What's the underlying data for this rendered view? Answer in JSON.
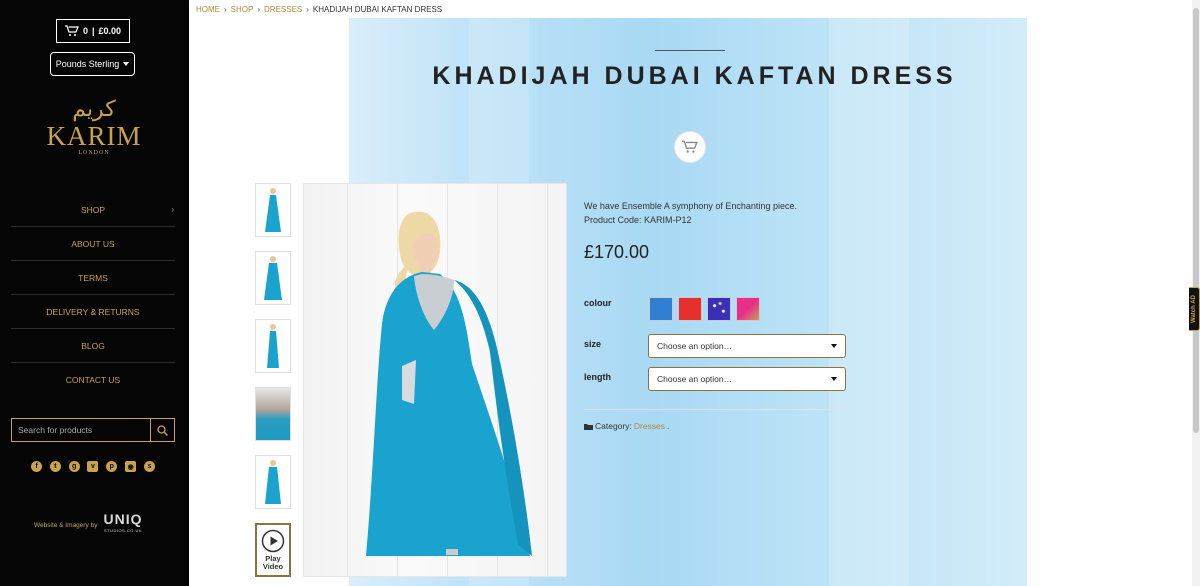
{
  "header": {
    "cart_count": "0",
    "cart_total": "£0.00",
    "currency": "Pounds Sterling"
  },
  "logo": {
    "arabic": "كريم",
    "name": "KARIM",
    "sub": "LONDON"
  },
  "nav": {
    "items": [
      {
        "label": "SHOP"
      },
      {
        "label": "ABOUT US"
      },
      {
        "label": "TERMS"
      },
      {
        "label": "DELIVERY & RETURNS"
      },
      {
        "label": "BLOG"
      },
      {
        "label": "CONTACT US"
      }
    ]
  },
  "search": {
    "placeholder": "Search for products"
  },
  "social_icons": [
    "facebook-icon",
    "twitter-icon",
    "google-plus-icon",
    "vimeo-icon",
    "pinterest-icon",
    "instagram-icon",
    "skype-icon"
  ],
  "credit": {
    "text": "Website & Imagery by",
    "brand": "UNIQ",
    "brand_sub": "STUDIOS.CO.UK"
  },
  "breadcrumb": {
    "home": "HOME",
    "shop": "SHOP",
    "dresses": "DRESSES",
    "current": "KHADIJAH DUBAI KAFTAN DRESS"
  },
  "product": {
    "title": "KHADIJAH DUBAI KAFTAN DRESS",
    "description": "We have Ensemble A symphony of Enchanting piece.",
    "code": "Product Code: KARIM-P12",
    "price": "£170.00",
    "colour_label": "colour",
    "colours": [
      "#2f7fd3",
      "#e5302e",
      "#3a2fb8",
      "#e8308a"
    ],
    "size_label": "size",
    "size_value": "Choose an option…",
    "length_label": "length",
    "length_value": "Choose an option…",
    "category_label": "Category:",
    "category_value": "Dresses",
    "video_label_1": "Play",
    "video_label_2": "Video"
  },
  "watch_tab": "Watch AD",
  "colors": {
    "sidebar_bg": "#050505",
    "gold": "#c9a24a",
    "dress": "#1aa3cf"
  }
}
